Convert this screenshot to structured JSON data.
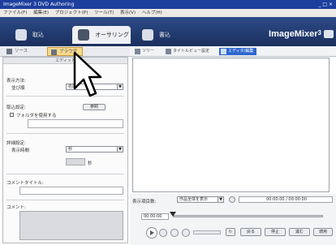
{
  "window": {
    "title": "ImageMixer 3 DVD Authoring",
    "controls": "_ □ ×"
  },
  "menu": [
    "ファイル(F)",
    "編集(E)",
    "プロジェクト(P)",
    "ツール(T)",
    "表示(V)",
    "ヘルプ(H)"
  ],
  "top_tabs": [
    {
      "label": "取込",
      "active": false
    },
    {
      "label": "オーサリング",
      "active": true
    },
    {
      "label": "書込",
      "active": false
    }
  ],
  "brand": {
    "name": "ImageMixer",
    "version": "3"
  },
  "sub_tabs": [
    {
      "label": "ソース",
      "active": false
    },
    {
      "label": "ブラウザ",
      "active": true
    }
  ],
  "right_toolbar": [
    {
      "label": "ツリー",
      "active": false
    },
    {
      "label": "タイトルビュー設定",
      "active": false
    },
    {
      "label": "エディタ/編集",
      "active": true
    }
  ],
  "left_panel": {
    "header": "エディット",
    "display_method_label": "表示方法:",
    "display_method_sub": "並び順",
    "display_method_value": "名前",
    "jump_label": "取込設定:",
    "jump_button": "参照",
    "jump_checkbox": "フォルダを使用する",
    "advanced_label": "詳細設定:",
    "advanced_sub": "表示時間",
    "advanced_value": "秒",
    "duration_unit": "秒",
    "comment_label": "コメントタイトル:",
    "memo_label": "コメント:"
  },
  "preview": {
    "count_label": "表示項目数:",
    "count_value": "作品全体を表示",
    "timecode_display": "00:00:00 / 00:00:00",
    "time_display": "00:00:00"
  },
  "playback": {
    "play_icon": "play-icon",
    "prev_btn": "戻る",
    "stop_btn": "停止",
    "next_btn": "進む",
    "apply_btn": "適用"
  }
}
